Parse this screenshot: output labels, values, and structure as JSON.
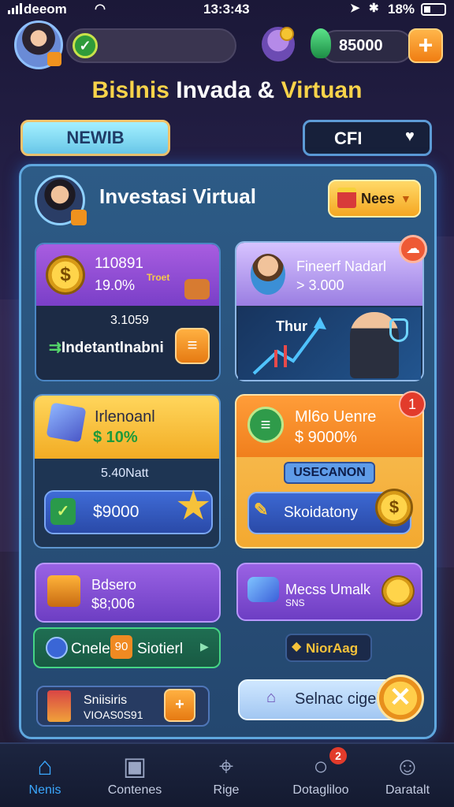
{
  "status_bar": {
    "carrier": "deeom",
    "time": "13:3:43",
    "battery": "18%"
  },
  "header": {
    "balance": "85000",
    "title_part1": "Bislnis",
    "title_part2": "Invada &",
    "title_part3": "Virtuan"
  },
  "tabs": {
    "left_label": "NEWIB",
    "right_label": "CFI"
  },
  "panel": {
    "title": "Investasi Virtual",
    "button_label": "Nees"
  },
  "cards": {
    "card1": {
      "value": "110891",
      "percent": "19.0%",
      "tag": "Troet",
      "mid_text": "3.1059",
      "action_label": "Indetantlnabni"
    },
    "card2": {
      "title": "Fineerf Nadarl",
      "subtitle": "> 3.000",
      "chart_label": "Thur"
    },
    "card3": {
      "title": "Irlenoanl",
      "percent": "$ 10%",
      "mid_text": "5.40Natt",
      "price": "$9000"
    },
    "card4": {
      "title": "Ml6o Uenre",
      "percent": "$ 9000%",
      "badge": "1",
      "chip": "USECANON",
      "action_label": "Skoidatony"
    },
    "card5": {
      "title": "Bdsero",
      "value": "$8;006",
      "label_left": "Cnele",
      "chip": "90",
      "label_right": "Siotierl"
    },
    "card6": {
      "title": "Mecss Umalk",
      "subtitle": "SNS",
      "button_label": "NiorAag"
    }
  },
  "bottom_buttons": {
    "left_title": "Sniisiris",
    "left_sub": "VIOAS0S91",
    "right_label": "Selnac cigel"
  },
  "nav": {
    "items": [
      {
        "label": "Nenis",
        "icon": "home-icon"
      },
      {
        "label": "Contenes",
        "icon": "chat-bot-icon"
      },
      {
        "label": "Rige",
        "icon": "target-icon"
      },
      {
        "label": "Dotagliloo",
        "icon": "message-icon"
      },
      {
        "label": "Daratalt",
        "icon": "profile-icon"
      }
    ],
    "badge": "2"
  },
  "colors": {
    "accent_blue": "#3ba8ff",
    "title_yellow": "#f8d34a",
    "orange": "#f07d12",
    "purple": "#7a3fc8"
  }
}
